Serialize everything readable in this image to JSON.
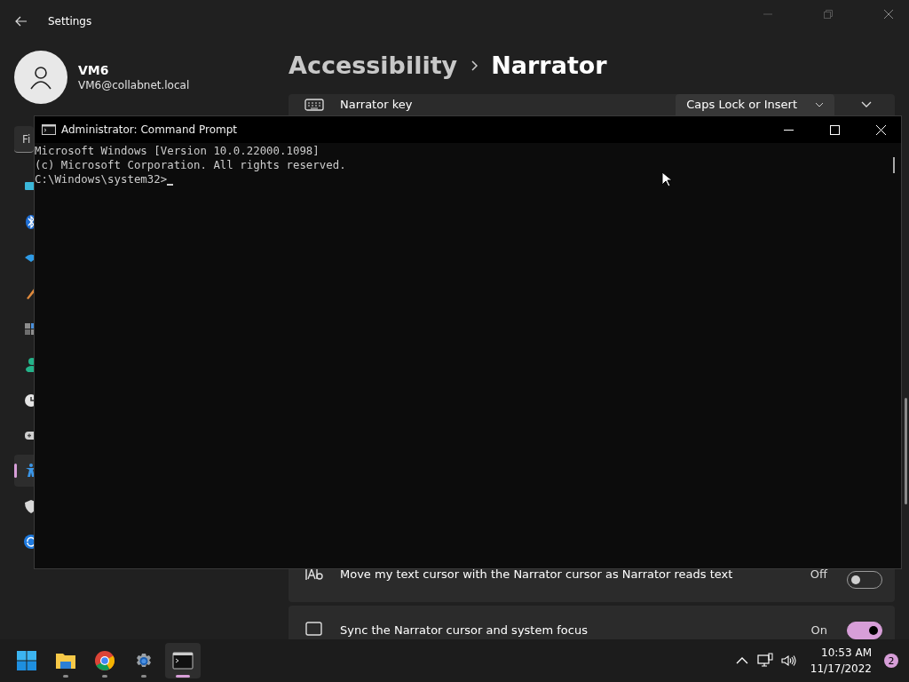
{
  "settings_window": {
    "title": "Settings",
    "user": {
      "name": "VM6",
      "email": "VM6@collabnet.local"
    },
    "search": {
      "placeholder": "Fi"
    },
    "nav_items": [
      {
        "kind": "system",
        "selected": false
      },
      {
        "kind": "bluetooth",
        "selected": false
      },
      {
        "kind": "network",
        "selected": false
      },
      {
        "kind": "personalization",
        "selected": false
      },
      {
        "kind": "apps",
        "selected": false
      },
      {
        "kind": "accounts",
        "selected": false
      },
      {
        "kind": "time",
        "selected": false
      },
      {
        "kind": "gaming",
        "selected": false
      },
      {
        "kind": "accessibility",
        "selected": true
      },
      {
        "kind": "privacy",
        "selected": false
      },
      {
        "kind": "update",
        "selected": false
      }
    ],
    "breadcrumb": [
      "Accessibility",
      "Narrator"
    ],
    "settings": [
      {
        "kind": "dropdown",
        "label": "Narrator key",
        "value": "Caps Lock or Insert"
      },
      {
        "kind": "toggle",
        "label": "Move my text cursor with the Narrator cursor as Narrator reads text",
        "state": "Off",
        "on": false
      },
      {
        "kind": "toggle",
        "label": "Sync the Narrator cursor and system focus",
        "state": "On",
        "on": true
      }
    ]
  },
  "console": {
    "title": "Administrator: Command Prompt",
    "lines": [
      "Microsoft Windows [Version 10.0.22000.1098]",
      "(c) Microsoft Corporation. All rights reserved.",
      "C:\\Windows\\system32>"
    ]
  },
  "taskbar": {
    "apps": [
      {
        "kind": "start",
        "running": false,
        "active": false
      },
      {
        "kind": "explorer",
        "running": true,
        "active": false
      },
      {
        "kind": "browser",
        "running": true,
        "active": false
      },
      {
        "kind": "settings",
        "running": true,
        "active": false
      },
      {
        "kind": "terminal",
        "running": true,
        "active": true
      }
    ],
    "time": "10:53 AM",
    "date": "11/17/2022",
    "notification_count": "2"
  }
}
